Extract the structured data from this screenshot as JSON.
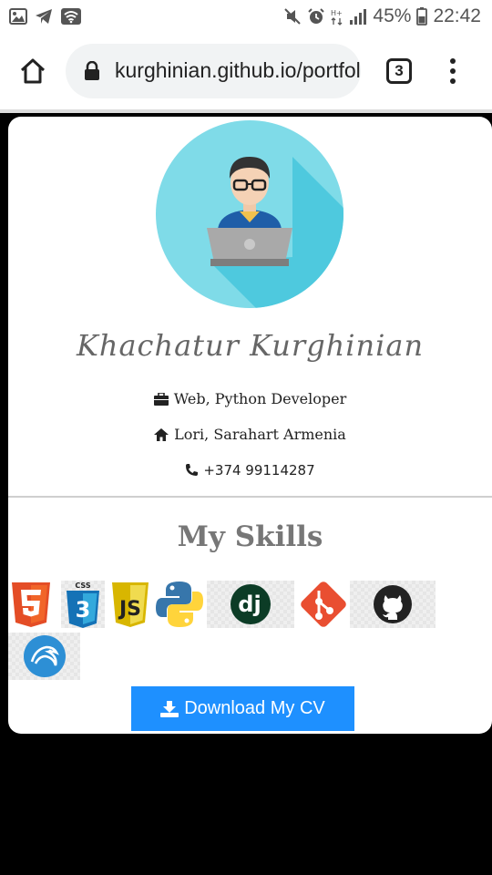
{
  "status_bar": {
    "battery": "45%",
    "time": "22:42"
  },
  "browser": {
    "url": "kurghinian.github.io/portfolio",
    "tab_count": "3"
  },
  "profile": {
    "name": "Khachatur Kurghinian",
    "role": "Web, Python Developer",
    "location": "Lori, Sarahart Armenia",
    "phone": "+374 99114287"
  },
  "skills": {
    "title": "My Skills",
    "items": [
      {
        "name": "html5-icon",
        "color": "#e44d26"
      },
      {
        "name": "css3-icon",
        "color": "#1572b6"
      },
      {
        "name": "javascript-icon",
        "color": "#f0db4f"
      },
      {
        "name": "python-icon",
        "color": "#3776ab"
      },
      {
        "name": "django-icon",
        "color": "#0c3c26"
      },
      {
        "name": "git-icon",
        "color": "#e94e31"
      },
      {
        "name": "github-icon",
        "color": "#222222"
      },
      {
        "name": "kali-linux-icon",
        "color": "#2d8fd5"
      }
    ]
  },
  "cv_button": {
    "label": "Download My CV"
  }
}
